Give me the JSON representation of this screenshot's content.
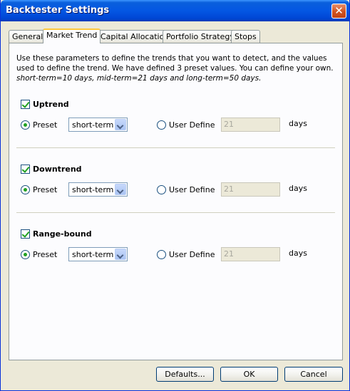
{
  "window": {
    "title": "Backtester Settings"
  },
  "tabs": [
    {
      "label": "General"
    },
    {
      "label": "Market Trend"
    },
    {
      "label": "Capital Allocation"
    },
    {
      "label": "Portfolio Strategy"
    },
    {
      "label": "Stops"
    }
  ],
  "active_tab": "Market Trend",
  "description": {
    "line1": "Use these parameters to define the trends that you want to detect, and the values",
    "line2": "used to define the trend. We have defined 3 preset values. You can define your own.",
    "line3": "short-term=10 days, mid-term=21 days and long-term=50 days."
  },
  "sections": [
    {
      "title": "Uptrend",
      "checked": true,
      "preset_label": "Preset",
      "preset_value": "short-term",
      "user_define_label": "User Define",
      "user_value": "21",
      "days_label": "days"
    },
    {
      "title": "Downtrend",
      "checked": true,
      "preset_label": "Preset",
      "preset_value": "short-term",
      "user_define_label": "User Define",
      "user_value": "21",
      "days_label": "days"
    },
    {
      "title": "Range-bound",
      "checked": true,
      "preset_label": "Preset",
      "preset_value": "short-term",
      "user_define_label": "User Define",
      "user_value": "21",
      "days_label": "days"
    }
  ],
  "buttons": {
    "defaults": "Defaults...",
    "ok": "OK",
    "cancel": "Cancel"
  },
  "colors": {
    "titlebar": "#0457e3",
    "active_tab_accent": "#ffc83c",
    "check_mark": "#21a121"
  }
}
